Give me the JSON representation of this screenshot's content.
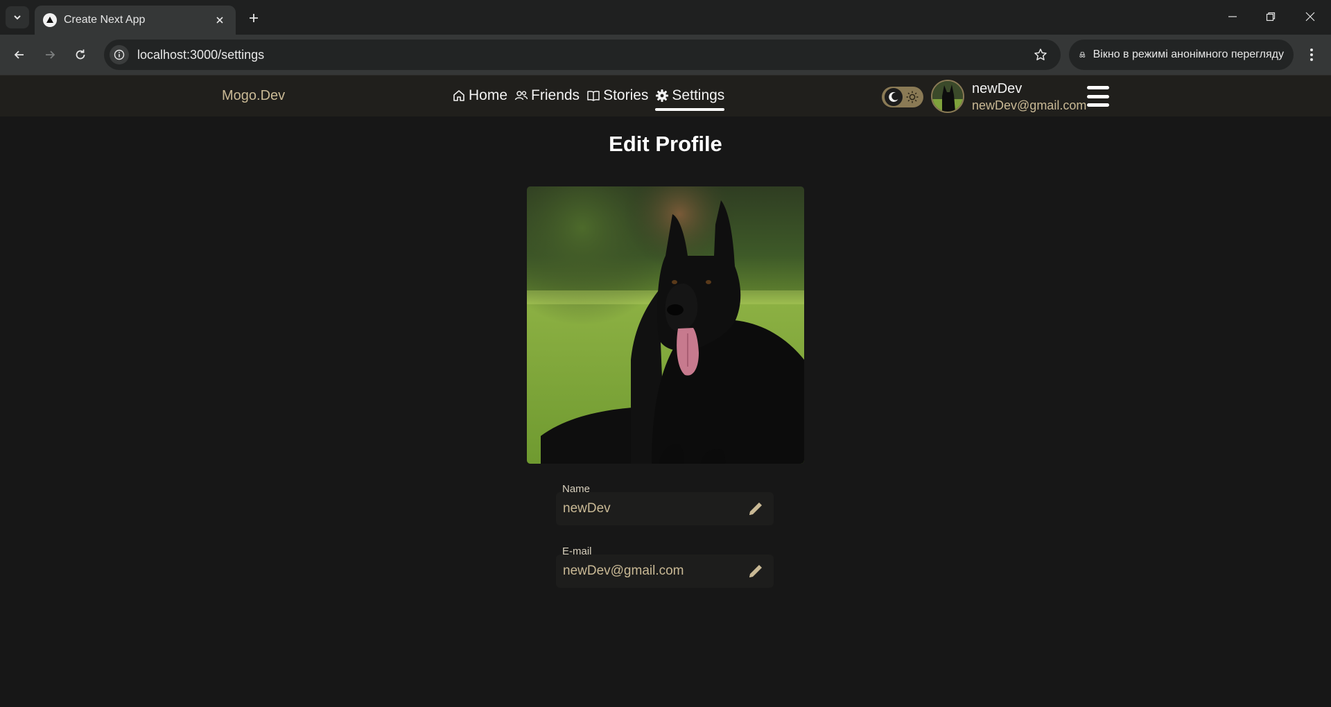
{
  "browser": {
    "tab_title": "Create Next App",
    "url": "localhost:3000/settings",
    "incognito_label": "Вікно в режимі анонімного перегляду"
  },
  "header": {
    "logo": "Mogo.Dev",
    "nav": [
      {
        "label": "Home",
        "icon": "home-icon"
      },
      {
        "label": "Friends",
        "icon": "users-icon"
      },
      {
        "label": "Stories",
        "icon": "book-icon"
      },
      {
        "label": "Settings",
        "icon": "gear-icon",
        "active": true
      }
    ],
    "user": {
      "name": "newDev",
      "email": "newDev@gmail.com"
    }
  },
  "main": {
    "title": "Edit Profile",
    "fields": [
      {
        "label": "Name",
        "value": "newDev"
      },
      {
        "label": "E-mail",
        "value": "newDev@gmail.com"
      }
    ]
  },
  "colors": {
    "accent": "#c9b995",
    "toggle": "#8a7a55",
    "background": "#171717",
    "header": "#201f1c"
  }
}
